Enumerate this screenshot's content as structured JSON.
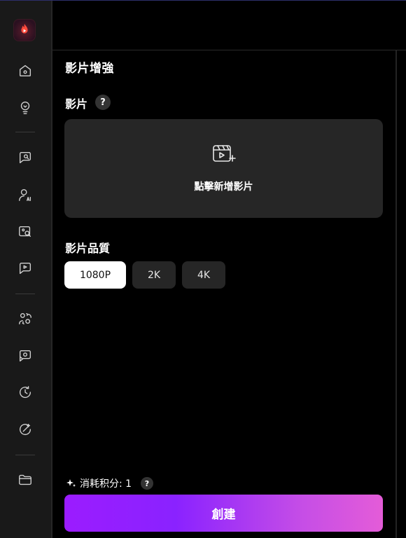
{
  "page": {
    "title": "影片增強"
  },
  "video": {
    "label": "影片",
    "help": "?",
    "upload_label": "點擊新增影片"
  },
  "quality": {
    "label": "影片品質",
    "options": [
      "1080P",
      "2K",
      "4K"
    ],
    "selected": "1080P"
  },
  "footer": {
    "cost_label": "消耗积分: 1",
    "help": "?",
    "create_label": "創建"
  },
  "sidebar": {
    "icons": [
      "home-icon",
      "lightbulb-icon",
      "chat-search-icon",
      "ai-avatar-icon",
      "image-search-icon",
      "video-swap-icon",
      "face-swap-icon",
      "video-chat-icon",
      "refresh-timer-icon",
      "magic-wand-icon",
      "folder-icon"
    ]
  },
  "colors": {
    "accent_start": "#9b1cff",
    "accent_end": "#e45cd8"
  }
}
